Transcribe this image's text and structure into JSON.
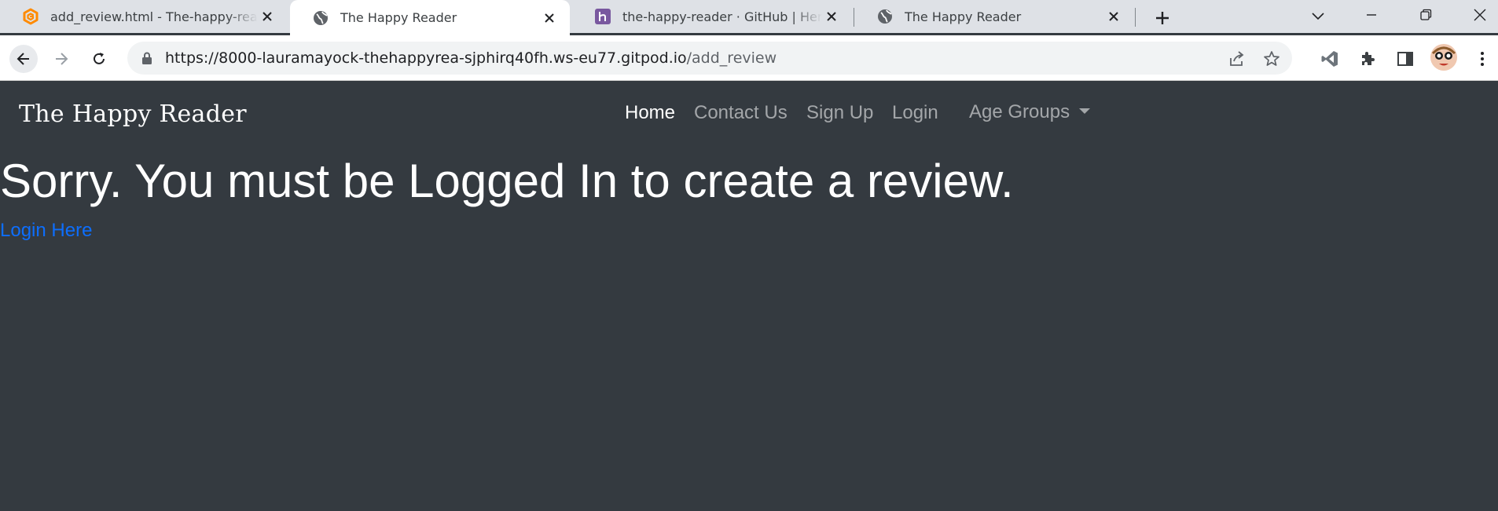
{
  "browser": {
    "tabs": [
      {
        "title": "add_review.html - The-happy-rea",
        "icon": "gitpod-icon",
        "active": false
      },
      {
        "title": "The Happy Reader",
        "icon": "globe-icon",
        "active": true
      },
      {
        "title": "the-happy-reader · GitHub | Hero",
        "icon": "heroku-icon",
        "active": false
      },
      {
        "title": "The Happy Reader",
        "icon": "globe-icon",
        "active": false
      }
    ],
    "url": {
      "host": "https://8000-lauramayock-thehappyrea-sjphirq40fh.ws-eu77.gitpod.io",
      "path": "/add_review"
    }
  },
  "navbar": {
    "brand": "The Happy Reader",
    "links": [
      {
        "label": "Home",
        "active": true
      },
      {
        "label": "Contact Us",
        "active": false
      },
      {
        "label": "Sign Up",
        "active": false
      },
      {
        "label": "Login",
        "active": false
      }
    ],
    "dropdown_label": "Age Groups"
  },
  "main": {
    "heading": "Sorry. You must be Logged In to create a review.",
    "login_link": "Login Here"
  },
  "colors": {
    "page_bg": "#343a40",
    "link": "#0d6efd",
    "tabstrip_bg": "#dee1e6"
  }
}
